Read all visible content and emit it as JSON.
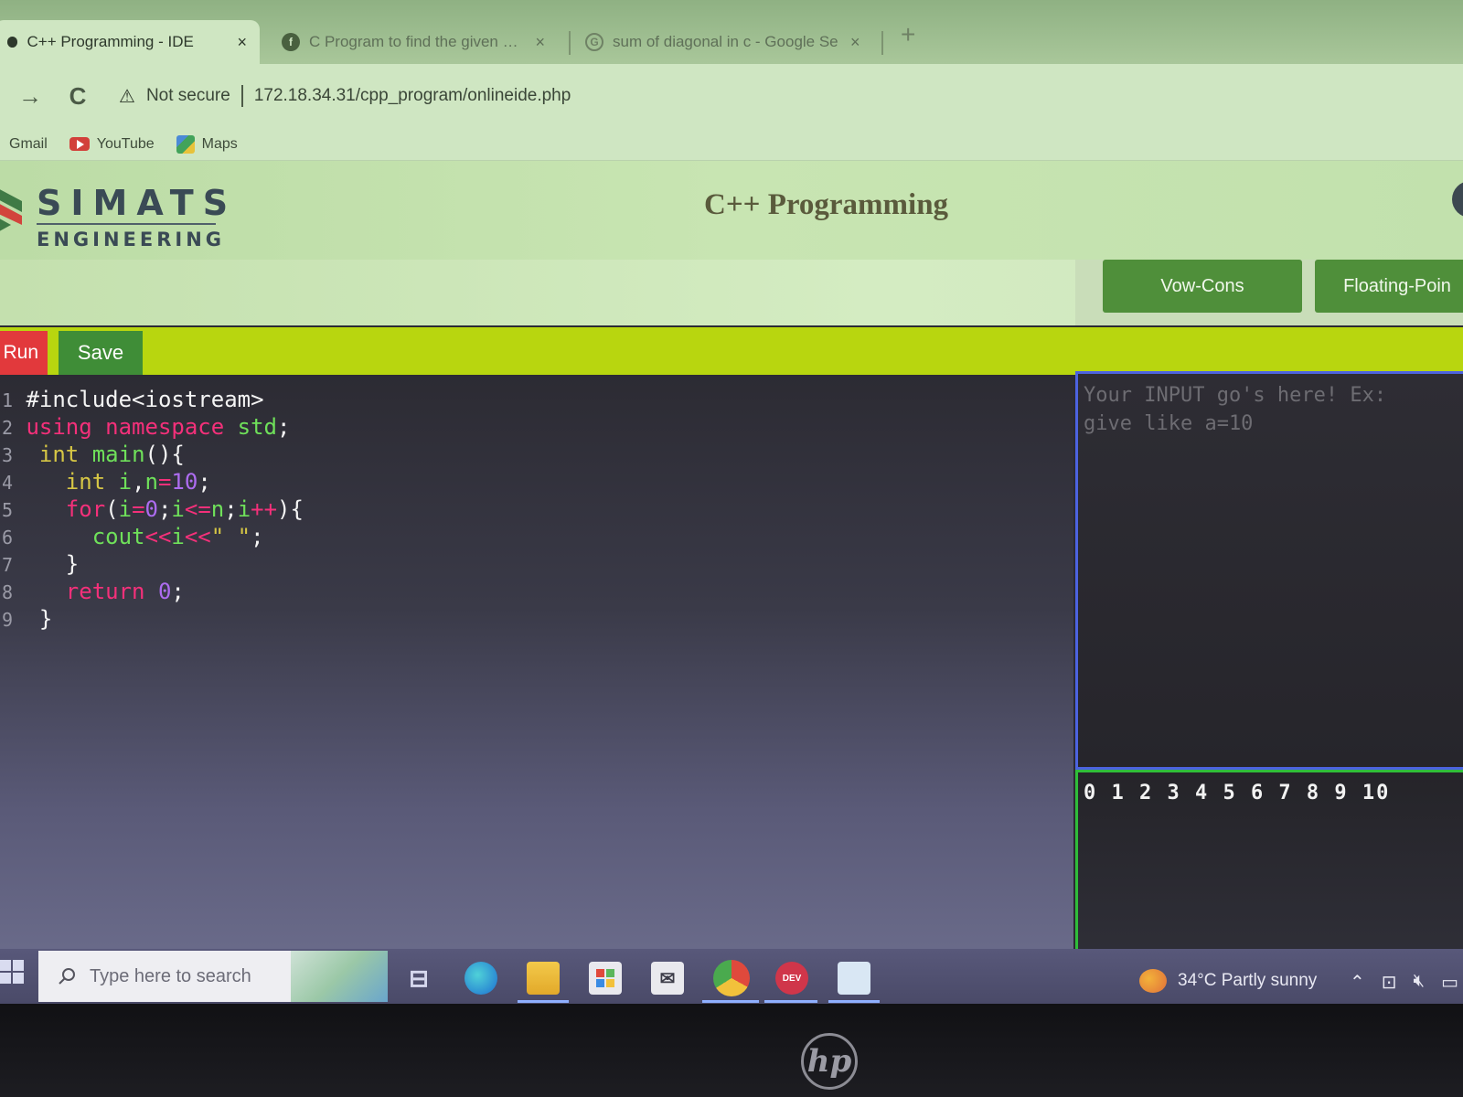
{
  "browser": {
    "tabs": [
      {
        "title": "C++ Programming - IDE",
        "close": "×",
        "active": true
      },
      {
        "title": "C Program to find the given num",
        "close": "×",
        "active": false
      },
      {
        "title": "sum of diagonal in c - Google Se",
        "close": "×",
        "active": false
      }
    ],
    "new_tab": "+",
    "nav": {
      "forward": "→",
      "reload": "C"
    },
    "security_label": "Not secure",
    "url": "172.18.34.31/cpp_program/onlineide.php",
    "bookmarks": [
      "Gmail",
      "YouTube",
      "Maps"
    ]
  },
  "site": {
    "logo_top": "SIMATS",
    "logo_bottom": "ENGINEERING",
    "title": "C++ Programming",
    "program_buttons": [
      "Vow-Cons",
      "Floating-Poin"
    ]
  },
  "toolbar": {
    "run_label": "Run",
    "save_label": "Save"
  },
  "editor": {
    "line_numbers": [
      "1",
      "2",
      "3",
      "4",
      "5",
      "6",
      "7",
      "8",
      "9"
    ]
  },
  "input": {
    "placeholder": "Your INPUT go's here! Ex:\ngive like a=10"
  },
  "output": {
    "text": "0 1 2 3 4 5 6 7 8 9 10"
  },
  "taskbar": {
    "search_placeholder": "Type here to search",
    "weather": "34°C  Partly sunny"
  },
  "colors": {
    "run_button": "#e2393c",
    "save_button": "#3f8d37",
    "action_bar": "#b8d60f",
    "program_button": "#4f8f3a",
    "input_border": "#4c63e0",
    "output_border": "#2fbd3a"
  }
}
